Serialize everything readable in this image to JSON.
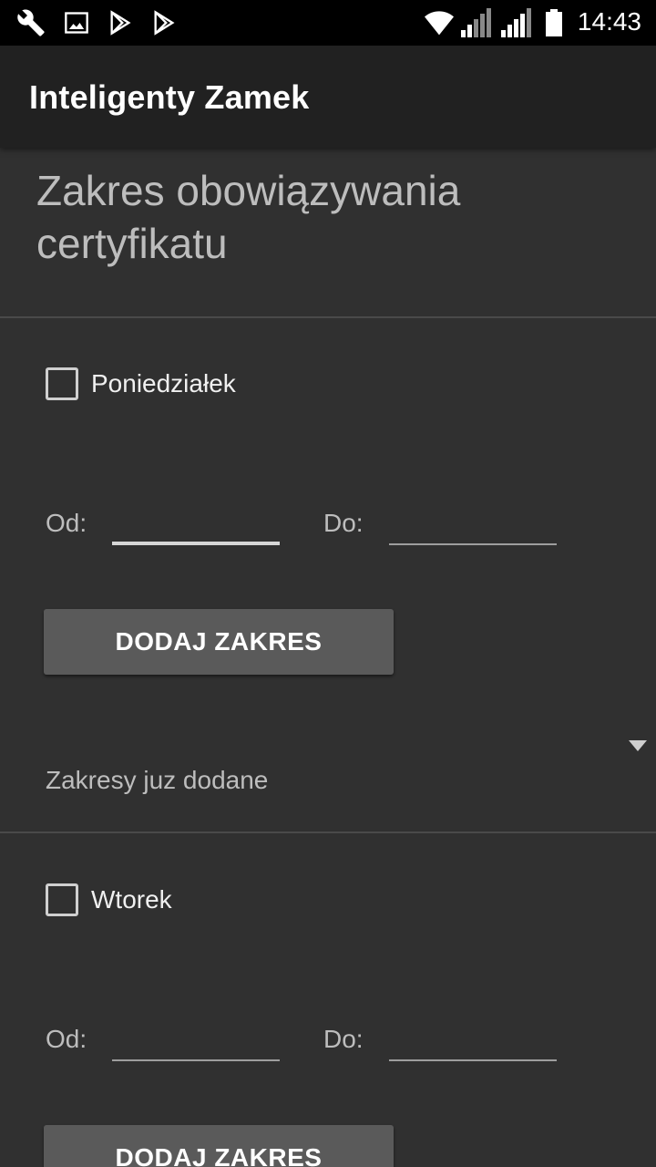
{
  "status_bar": {
    "icons": [
      "wrench-icon",
      "image-icon",
      "play-store-icon",
      "play-store-icon",
      "wifi-icon",
      "signal-icon",
      "signal-icon",
      "battery-icon"
    ],
    "time": "14:43"
  },
  "app_bar": {
    "title": "Inteligenty Zamek"
  },
  "section": {
    "title": "Zakres obowiązywania certyfikatu"
  },
  "days": [
    {
      "label": "Poniedziałek",
      "checked": false,
      "from_label": "Od:",
      "from_value": "",
      "to_label": "Do:",
      "to_value": "",
      "button_label": "DODAJ ZAKRES",
      "spinner_label": "Zakresy juz dodane"
    },
    {
      "label": "Wtorek",
      "checked": false,
      "from_label": "Od:",
      "from_value": "",
      "to_label": "Do:",
      "to_value": "",
      "button_label": "DODAJ ZAKRES"
    }
  ],
  "colors": {
    "background": "#303030",
    "app_bar": "#212121",
    "button": "#5a5a5a"
  }
}
